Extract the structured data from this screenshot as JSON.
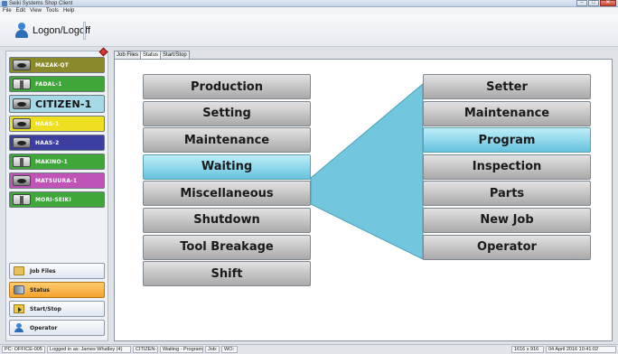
{
  "window": {
    "title": "Seiki Systems Shop Client",
    "buttons": {
      "minimize": "–",
      "maximize": "□",
      "close": "✕"
    }
  },
  "menu": [
    "File",
    "Edit",
    "View",
    "Tools",
    "Help"
  ],
  "toolbar": {
    "logon_label": "Logon/Logoff"
  },
  "machines": [
    {
      "label": "MAZAK-QT",
      "type": "lathe",
      "color": "#8a8a2c",
      "big": false
    },
    {
      "label": "FADAL-1",
      "type": "mill",
      "color": "#3fa63a",
      "big": false
    },
    {
      "label": "CITIZEN-1",
      "type": "lathe",
      "color": "#a5d9e6",
      "big": true
    },
    {
      "label": "HAAS-1",
      "type": "lathe",
      "color": "#eee020",
      "big": false
    },
    {
      "label": "HAAS-2",
      "type": "lathe",
      "color": "#3c3ea0",
      "big": false
    },
    {
      "label": "MAKINO-1",
      "type": "mill",
      "color": "#3fa63a",
      "big": false
    },
    {
      "label": "MATSUURA-1",
      "type": "lathe",
      "color": "#c054b6",
      "big": false
    },
    {
      "label": "MORI-SEIKI",
      "type": "mill",
      "color": "#3fa63a",
      "big": false
    }
  ],
  "nav": [
    {
      "label": "Job Files",
      "icon": "folder-icon",
      "active": false
    },
    {
      "label": "Status",
      "icon": "status-icon",
      "active": true
    },
    {
      "label": "Start/Stop",
      "icon": "start-stop-icon",
      "active": false
    },
    {
      "label": "Operator",
      "icon": "operator-icon",
      "active": false
    }
  ],
  "tabs": [
    {
      "label": "Job Files",
      "active": false
    },
    {
      "label": "Status",
      "active": true
    },
    {
      "label": "Start/Stop",
      "active": false
    }
  ],
  "status_categories": [
    {
      "label": "Production",
      "selected": false
    },
    {
      "label": "Setting",
      "selected": false
    },
    {
      "label": "Maintenance",
      "selected": false
    },
    {
      "label": "Waiting",
      "selected": true
    },
    {
      "label": "Miscellaneous",
      "selected": false
    },
    {
      "label": "Shutdown",
      "selected": false
    },
    {
      "label": "Tool Breakage",
      "selected": false
    },
    {
      "label": "Shift",
      "selected": false
    }
  ],
  "waiting_reasons": [
    {
      "label": "Setter",
      "selected": false
    },
    {
      "label": "Maintenance",
      "selected": false
    },
    {
      "label": "Program",
      "selected": true
    },
    {
      "label": "Inspection",
      "selected": false
    },
    {
      "label": "Parts",
      "selected": false
    },
    {
      "label": "New Job",
      "selected": false
    },
    {
      "label": "Operator",
      "selected": false
    }
  ],
  "statusbar": {
    "pc": "PC: OFFICE-005",
    "logged": "Logged in as: James Whatley (4)",
    "machine": "CITIZEN-1",
    "state": "Waiting - Program",
    "job": "Job:",
    "wo": "WO:",
    "resolution": "1616 x 916",
    "datetime": "04 April 2016 10:41:02"
  },
  "colors": {
    "selected_accent": "#66c2df",
    "active_nav": "#f4a22e"
  }
}
